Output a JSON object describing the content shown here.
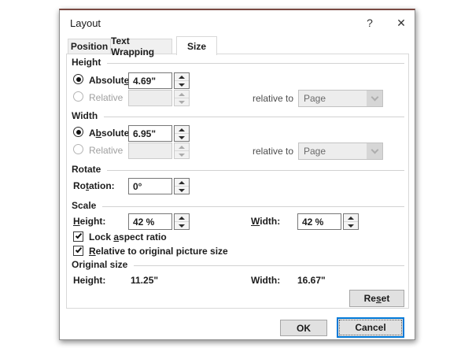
{
  "colors": {
    "accent": "#0078d7",
    "dialog_border": "#8e8e8e"
  },
  "titlebar": {
    "title": "Layout",
    "help_icon": "?",
    "close_icon": "✕"
  },
  "tabs": {
    "position": "Position",
    "text_wrapping": "Text Wrapping",
    "size": "Size"
  },
  "height": {
    "header": "Height",
    "absolute": {
      "pre": "Absolut",
      "u": "e",
      "post": ""
    },
    "absolute_value": "4.69\"",
    "relative_label": "Relative",
    "relative_value": "",
    "relative_to_label": "relative to",
    "relative_to_value": "Page"
  },
  "width": {
    "header": "Width",
    "absolute": {
      "pre": "A",
      "u": "b",
      "post": "solute"
    },
    "absolute_value": "6.95\"",
    "relative_label": "Relative",
    "relative_value": "",
    "relative_to_label": "relative to",
    "relative_to_value": "Page"
  },
  "rotate": {
    "header": "Rotate",
    "rotation_label": {
      "pre": "Ro",
      "u": "t",
      "post": "ation:"
    },
    "value": "0°"
  },
  "scale": {
    "header": "Scale",
    "height_label": {
      "pre": "",
      "u": "H",
      "post": "eight:"
    },
    "height_value": "42 %",
    "width_label": {
      "pre": "",
      "u": "W",
      "post": "idth:"
    },
    "width_value": "42 %",
    "lock_aspect": {
      "pre": "Lock ",
      "u": "a",
      "post": "spect ratio",
      "checked": true
    },
    "relative_original": {
      "pre": "",
      "u": "R",
      "post": "elative to original picture size",
      "checked": true
    }
  },
  "original": {
    "header": "Original size",
    "height_label": "Height:",
    "height_value": "11.25\"",
    "width_label": "Width:",
    "width_value": "16.67\"",
    "reset": {
      "pre": "Re",
      "u": "s",
      "post": "et"
    }
  },
  "buttons": {
    "ok": "OK",
    "cancel": "Cancel"
  }
}
